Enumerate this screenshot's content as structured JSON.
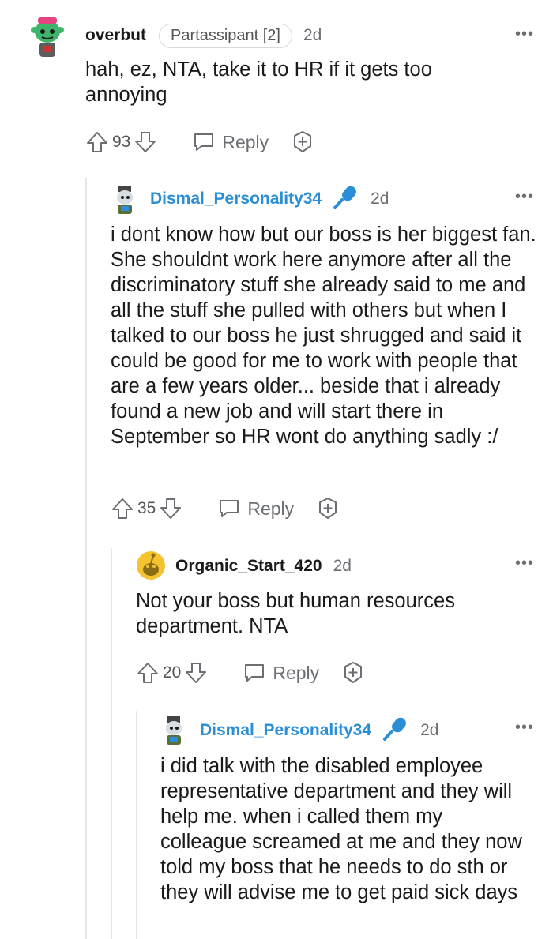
{
  "comments": [
    {
      "username": "overbut",
      "flair": "Partassipant [2]",
      "time": "2d",
      "body": "hah, ez, NTA, take it to HR if it gets too annoying",
      "votes": "93",
      "reply_label": "Reply"
    },
    {
      "username": "Dismal_Personality34",
      "time": "2d",
      "body": "i dont know how but our boss is her biggest fan. She shouldnt work here anymore after all the discriminatory stuff she already said to me and all the stuff she pulled with others but when I talked to our boss he just shrugged and said it could be good for me to work with people that are a few years older... beside that i already found a new job and will start there in September so HR wont do anything sadly :/",
      "votes": "35",
      "reply_label": "Reply"
    },
    {
      "username": "Organic_Start_420",
      "time": "2d",
      "body": "Not your boss but human resources department. NTA",
      "votes": "20",
      "reply_label": "Reply"
    },
    {
      "username": "Dismal_Personality34",
      "time": "2d",
      "body": "i did talk with the disabled employee representative department and they will help me. when i called them my colleague screamed at me and they now told my boss that he needs to do sth or they will advise me to get paid sick days"
    }
  ],
  "more_label": "•••",
  "colors": {
    "op_username": "#2a8fd6",
    "text": "#1a1a1b",
    "muted": "#6b6e72",
    "thread_line": "#e4e6e8"
  },
  "icons": [
    "upvote-icon",
    "downvote-icon",
    "reply-icon",
    "award-icon",
    "microphone-icon",
    "more-options-icon"
  ]
}
